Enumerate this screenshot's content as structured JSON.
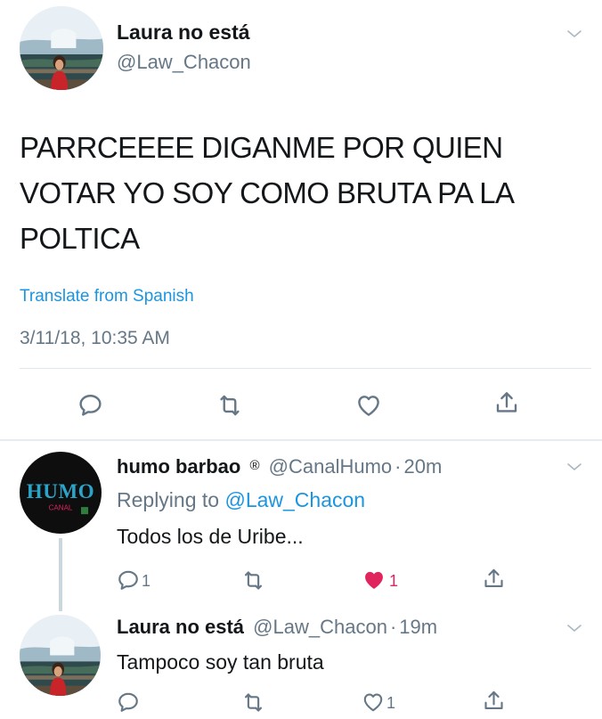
{
  "main_tweet": {
    "display_name": "Laura no está",
    "handle": "@Law_Chacon",
    "text_lines": [
      "PARRCEEEE DIGANME POR QUIEN",
      "VOTAR YO SOY COMO BRUTA PA LA",
      "POLTICA"
    ],
    "translate": "Translate from Spanish",
    "timestamp": "3/11/18, 10:35 AM"
  },
  "reply1": {
    "display_name": "humo barbao",
    "verified_mark": "®",
    "handle": "@CanalHumo",
    "dot": "·",
    "time": "20m",
    "replying_prefix": "Replying to",
    "replying_handle": "@Law_Chacon",
    "text": "Todos los de Uribe...",
    "reply_count": "1",
    "like_count": "1",
    "avatar_logo": "HUMO",
    "avatar_sub": "CANAL",
    "liked_color": "#e0245e"
  },
  "reply2": {
    "display_name": "Laura no está",
    "handle": "@Law_Chacon",
    "dot": "·",
    "time": "19m",
    "text": "Tampoco soy tan bruta",
    "like_count": "1"
  },
  "icons": {
    "reply": "speech-bubble",
    "retweet": "retweet-arrows",
    "like": "heart-outline",
    "liked": "heart-filled",
    "share": "share-arrow-up",
    "menu": "chevron-down"
  }
}
